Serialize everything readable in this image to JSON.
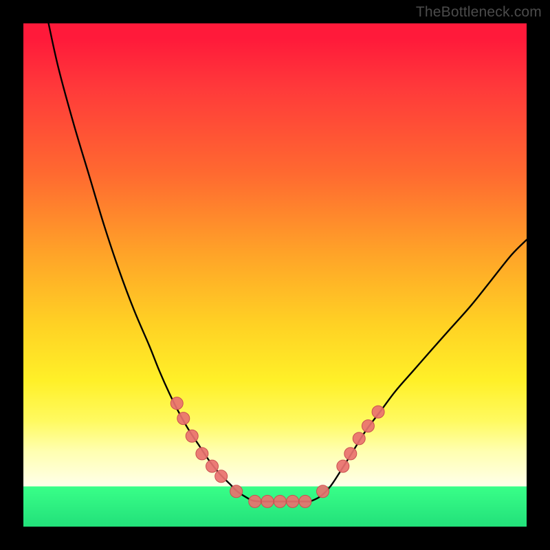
{
  "watermark": "TheBottleneck.com",
  "colors": {
    "background": "#000000",
    "gradient_stops": [
      "#ff1a3a",
      "#ff3a3a",
      "#ff6a30",
      "#ffa428",
      "#ffd224",
      "#fff028",
      "#fffa60",
      "#ffffb0",
      "#ffffe6",
      "#39ff88",
      "#22e07a"
    ],
    "curve_stroke": "#000000",
    "marker_fill": "#e9716f",
    "marker_stroke": "#c94f4f"
  },
  "chart_data": {
    "type": "line",
    "title": "",
    "xlabel": "",
    "ylabel": "",
    "xlim": [
      0,
      100
    ],
    "ylim": [
      0,
      100
    ],
    "grid": false,
    "legend": false,
    "series": [
      {
        "name": "left-curve",
        "x": [
          5,
          7,
          10,
          13,
          16,
          19,
          22,
          25,
          27,
          29,
          31,
          33,
          35,
          37,
          39,
          41,
          42.5,
          44,
          45.5,
          47
        ],
        "y": [
          100,
          91,
          80,
          70,
          60,
          51,
          43,
          36,
          31,
          26.5,
          22.5,
          19,
          16,
          13,
          10.5,
          8.5,
          7,
          6,
          5.2,
          5
        ]
      },
      {
        "name": "bottom-flat",
        "x": [
          47,
          49,
          51,
          53,
          55,
          57
        ],
        "y": [
          5,
          5,
          5,
          5,
          5,
          5
        ]
      },
      {
        "name": "right-curve",
        "x": [
          57,
          59,
          61,
          63,
          65.5,
          68,
          71,
          74,
          77.5,
          81,
          85,
          89,
          93,
          97,
          100
        ],
        "y": [
          5,
          6,
          8,
          11,
          15,
          19,
          23,
          27,
          31,
          35,
          39.5,
          44,
          49,
          54,
          57
        ]
      }
    ],
    "markers": {
      "name": "marker-dots",
      "radius": 9,
      "points": [
        {
          "x": 30.5,
          "y": 24.5
        },
        {
          "x": 31.8,
          "y": 21.5
        },
        {
          "x": 33.5,
          "y": 18.0
        },
        {
          "x": 35.5,
          "y": 14.5
        },
        {
          "x": 37.5,
          "y": 12.0
        },
        {
          "x": 39.3,
          "y": 10.0
        },
        {
          "x": 42.3,
          "y": 7.0
        },
        {
          "x": 46.0,
          "y": 5.0
        },
        {
          "x": 48.5,
          "y": 5.0
        },
        {
          "x": 51.0,
          "y": 5.0
        },
        {
          "x": 53.5,
          "y": 5.0
        },
        {
          "x": 56.0,
          "y": 5.0
        },
        {
          "x": 59.5,
          "y": 7.0
        },
        {
          "x": 63.5,
          "y": 12.0
        },
        {
          "x": 65.0,
          "y": 14.5
        },
        {
          "x": 66.7,
          "y": 17.5
        },
        {
          "x": 68.5,
          "y": 20.0
        },
        {
          "x": 70.5,
          "y": 22.8
        }
      ]
    }
  }
}
